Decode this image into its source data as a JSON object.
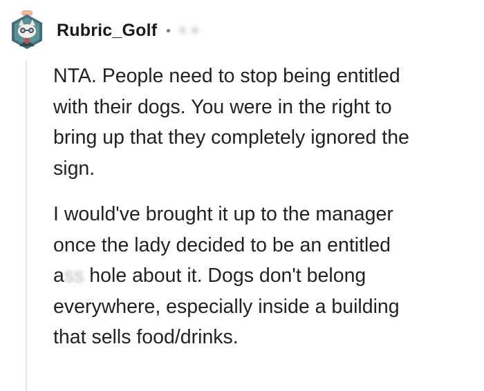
{
  "comment": {
    "author": "Rubric_Golf",
    "timestamp": "• •",
    "avatar": {
      "icon": "cat-face-snoo-avatar",
      "badge": "award-badge-icon",
      "background_color": "#3f6f78",
      "accent_color": "#f0a8b0"
    },
    "paragraphs": [
      {
        "lines": [
          "NTA. People need to stop being entitled",
          "with their dogs. You were in the right to",
          "bring up that they completely ignored the",
          "sign."
        ]
      },
      {
        "lines_before": [
          "I would've brought it up to the manager",
          "once the lady decided to be an entitled"
        ],
        "redacted_line": {
          "prefix": "a",
          "redacted": "ss",
          "suffix": "hole about it. Dogs don't belong"
        },
        "lines_after": [
          "everywhere, especially inside a building",
          "that sells food/drinks."
        ]
      }
    ]
  }
}
